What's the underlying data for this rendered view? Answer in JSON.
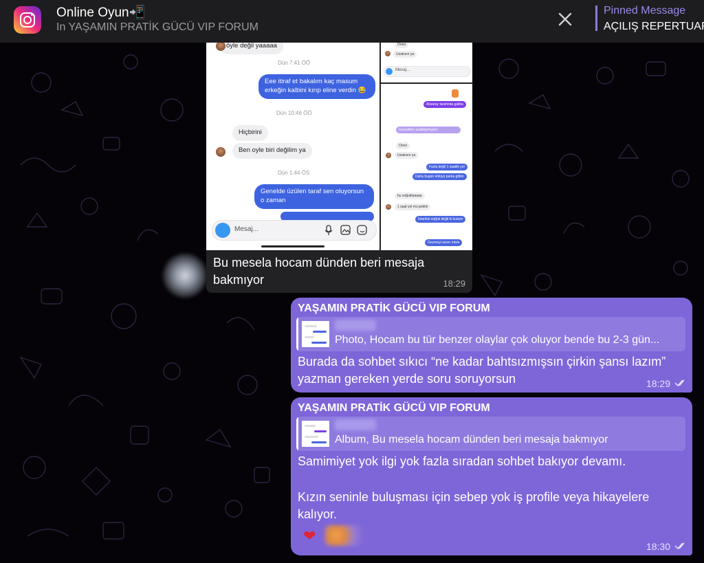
{
  "notification": {
    "title": "Online Oyun📲",
    "subtitle": "In YAŞAMIN PRATİK GÜCÜ VIP FORUM",
    "app_icon": "instagram-icon",
    "pinned_label": "Pinned Message",
    "pinned_text": "AÇILIŞ REPERTUAR"
  },
  "incoming": {
    "screenshot_main": {
      "top_bubble": "öyle değil yaaaaa",
      "ts1": "Dün 7:41 ÖÖ",
      "out1": "Eee itiraf et bakalım kaç masum erkeğin kalbini kırıp eline verdin 😂",
      "ts2": "Dün 10:46 ÖÖ",
      "in1": "Hiçbirini",
      "in2": "Ben oyle biri değilim ya",
      "ts3": "Dün 1:44 ÖS",
      "out2": "Genelde üzülen taraf sen oluyorsun o zaman",
      "compose_placeholder": "Mesaj..."
    },
    "screenshot_side_top": {
      "l1": "Oooo",
      "l2": "Uzakısın ya",
      "compose_placeholder": "Mesaj..."
    },
    "screenshot_side_bottom": {
      "l1": "Aksaray tarafında galiba",
      "l2": "Gerçekten uzaktaymışsın",
      "l3": "Oooo",
      "l4": "Uzakısın ya",
      "l5": "Fazla değil 1 saatlik yol",
      "l6": "Daha bugün kötüye parka gittim",
      "l7": "bu soğuktaaaaa",
      "l8": "1 saat yol mu pektin",
      "l9": "İstanbul soğuk değil ki kuzum",
      "l10": "Gezmeyi sever misin"
    },
    "caption": "Bu mesela hocam dünden beri mesaja bakmıyor",
    "time": "18:29"
  },
  "replies": [
    {
      "group": "YAŞAMIN PRATİK GÜCÜ VIP FORUM",
      "quote": "Photo, Hocam bu tür benzer olaylar çok oluyor bende bu 2-3 gün...",
      "body": "Burada da sohbet sıkıcı “ne kadar bahtsızmışsın çirkin şansı lazım” yazman gereken yerde soru soruyorsun",
      "time": "18:29"
    },
    {
      "group": "YAŞAMIN PRATİK GÜCÜ VIP FORUM",
      "quote": "Album, Bu mesela hocam dünden beri mesaja bakmıyor",
      "body1": "Samimiyet yok ilgi yok fazla sıradan sohbet bakıyor devamı.",
      "body2": "Kızın seninle buluşması için sebep yok iş profile veya hikayelere kalıyor.",
      "reaction": "❤",
      "time": "18:30"
    }
  ],
  "colors": {
    "out_bubble": "#7e66d9",
    "in_bubble": "#222224",
    "pinned_accent": "#9b88e6"
  }
}
